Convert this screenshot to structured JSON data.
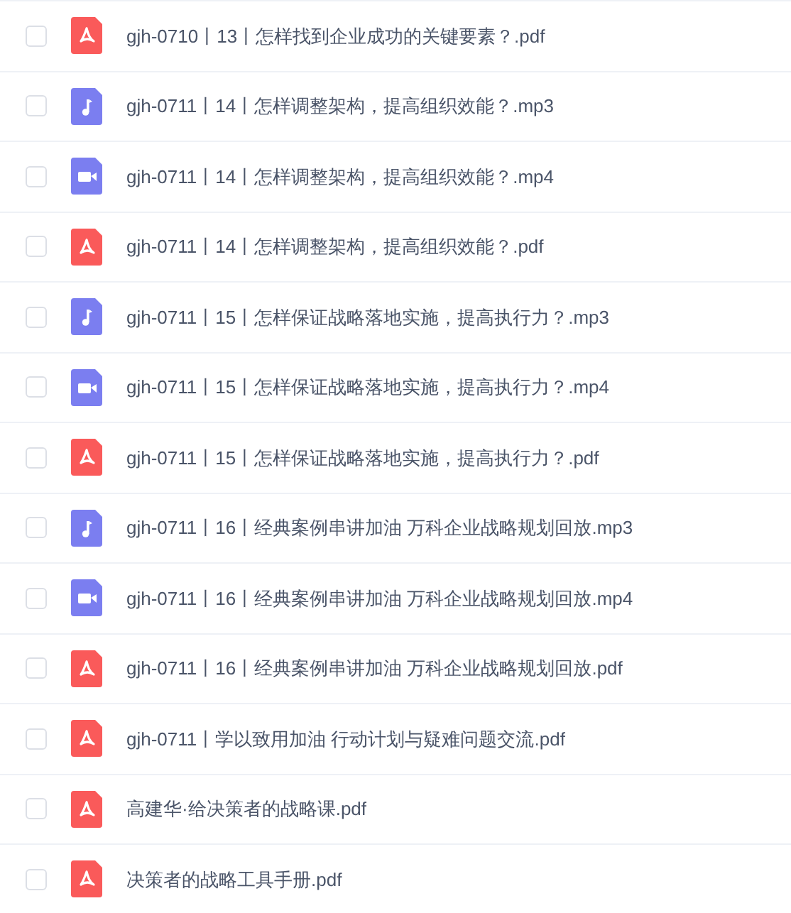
{
  "files": [
    {
      "kind": "pdf",
      "name": "gjh-0710丨13丨怎样找到企业成功的关键要素？.pdf",
      "checked": false
    },
    {
      "kind": "audio",
      "name": "gjh-0711丨14丨怎样调整架构，提高组织效能？.mp3",
      "checked": false
    },
    {
      "kind": "video",
      "name": "gjh-0711丨14丨怎样调整架构，提高组织效能？.mp4",
      "checked": false
    },
    {
      "kind": "pdf",
      "name": "gjh-0711丨14丨怎样调整架构，提高组织效能？.pdf",
      "checked": false
    },
    {
      "kind": "audio",
      "name": "gjh-0711丨15丨怎样保证战略落地实施，提高执行力？.mp3",
      "checked": false
    },
    {
      "kind": "video",
      "name": "gjh-0711丨15丨怎样保证战略落地实施，提高执行力？.mp4",
      "checked": false
    },
    {
      "kind": "pdf",
      "name": "gjh-0711丨15丨怎样保证战略落地实施，提高执行力？.pdf",
      "checked": false
    },
    {
      "kind": "audio",
      "name": "gjh-0711丨16丨经典案例串讲加油 万科企业战略规划回放.mp3",
      "checked": false
    },
    {
      "kind": "video",
      "name": "gjh-0711丨16丨经典案例串讲加油 万科企业战略规划回放.mp4",
      "checked": false
    },
    {
      "kind": "pdf",
      "name": "gjh-0711丨16丨经典案例串讲加油 万科企业战略规划回放.pdf",
      "checked": false
    },
    {
      "kind": "pdf",
      "name": "gjh-0711丨学以致用加油 行动计划与疑难问题交流.pdf",
      "checked": false
    },
    {
      "kind": "pdf",
      "name": "高建华·给决策者的战略课.pdf",
      "checked": false
    },
    {
      "kind": "pdf",
      "name": "决策者的战略工具手册.pdf",
      "checked": false
    }
  ]
}
